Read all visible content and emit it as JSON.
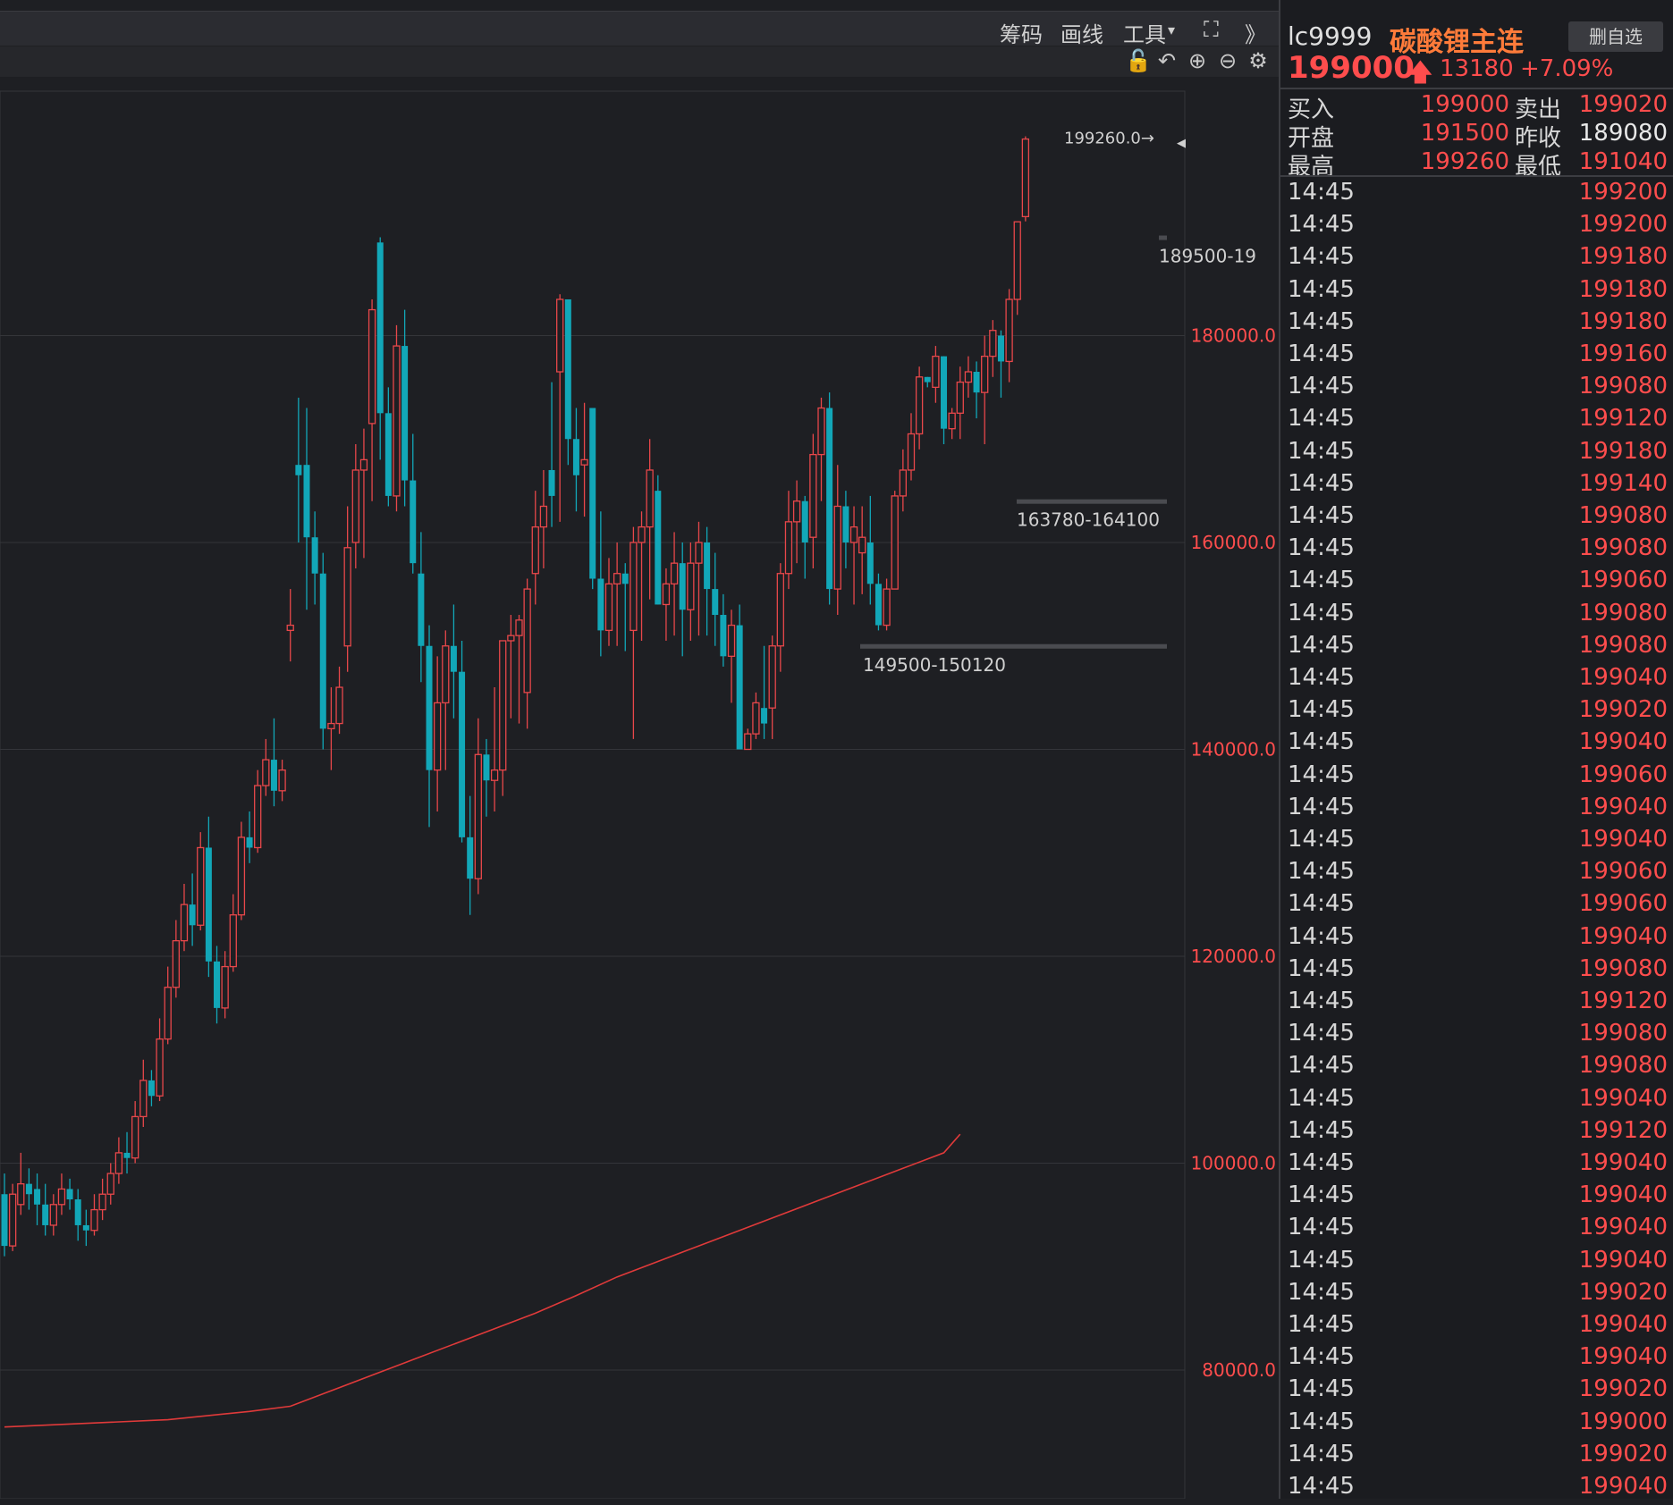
{
  "toolbar": {
    "items": [
      "筹码",
      "画线",
      "工具"
    ],
    "dropdown_glyph": "▾",
    "expand_glyph": "⛶",
    "more_glyph": "》"
  },
  "subbar": {
    "icons": [
      "lock-icon",
      "undo-icon",
      "zoom-in-icon",
      "zoom-out-icon",
      "settings-icon"
    ],
    "glyphs": [
      "🔓",
      "↶",
      "⊕",
      "⊖",
      "⚙"
    ]
  },
  "chart": {
    "y_ticks": [
      "180000.0",
      "160000.0",
      "140000.0",
      "120000.0",
      "100000.0",
      "80000.0"
    ],
    "annotations": {
      "high": "199260.0→",
      "zone1": "189500-19",
      "zone2": "163780-164100",
      "zone3": "149500-150120"
    },
    "colors": {
      "up": "#e8474a",
      "down": "#12a7b8",
      "ma": "#e03a3a",
      "grid": "#34353a"
    }
  },
  "chart_data": {
    "type": "candlestick",
    "ylim": [
      70000,
      205000
    ],
    "y_ticks": [
      80000,
      100000,
      120000,
      140000,
      160000,
      180000
    ],
    "candles": [
      [
        97000,
        92000,
        99000,
        91000
      ],
      [
        92000,
        97000,
        98000,
        91500
      ],
      [
        96000,
        98000,
        101000,
        95000
      ],
      [
        98000,
        97000,
        99500,
        95500
      ],
      [
        97500,
        96000,
        99000,
        94000
      ],
      [
        96000,
        94000,
        98000,
        93000
      ],
      [
        94000,
        96000,
        97000,
        93000
      ],
      [
        96000,
        97500,
        99000,
        95000
      ],
      [
        97500,
        96500,
        98500,
        95500
      ],
      [
        96500,
        94000,
        97500,
        92500
      ],
      [
        94000,
        93500,
        95500,
        92000
      ],
      [
        93500,
        95500,
        97000,
        93000
      ],
      [
        95500,
        97000,
        98500,
        94500
      ],
      [
        97000,
        99000,
        100000,
        96000
      ],
      [
        99000,
        101000,
        102500,
        98000
      ],
      [
        101000,
        100500,
        103000,
        99000
      ],
      [
        100500,
        104500,
        106000,
        100000
      ],
      [
        104500,
        108000,
        110000,
        103500
      ],
      [
        108000,
        106500,
        109000,
        105500
      ],
      [
        106500,
        112000,
        114000,
        106000
      ],
      [
        112000,
        117000,
        119000,
        111500
      ],
      [
        117000,
        121500,
        123500,
        116000
      ],
      [
        121500,
        125000,
        127000,
        120500
      ],
      [
        125000,
        123000,
        128000,
        121000
      ],
      [
        123000,
        130500,
        132000,
        122500
      ],
      [
        130500,
        119500,
        133500,
        118000
      ],
      [
        119500,
        115000,
        121000,
        113500
      ],
      [
        115000,
        119000,
        120500,
        114000
      ],
      [
        119000,
        124000,
        126000,
        118500
      ],
      [
        124000,
        131500,
        133000,
        123500
      ],
      [
        131500,
        130500,
        134000,
        129000
      ],
      [
        130500,
        136500,
        138000,
        130000
      ],
      [
        136500,
        139000,
        141000,
        135500
      ],
      [
        139000,
        136000,
        143000,
        134500
      ],
      [
        136000,
        138000,
        139000,
        135000
      ],
      [
        151500,
        152000,
        155500,
        148500
      ],
      [
        167500,
        166500,
        174000,
        160000
      ],
      [
        167500,
        160500,
        173000,
        153500
      ],
      [
        160500,
        157000,
        163000,
        154000
      ],
      [
        157000,
        142000,
        159000,
        140000
      ],
      [
        142000,
        142500,
        146000,
        138000
      ],
      [
        142500,
        146000,
        148000,
        141500
      ],
      [
        150000,
        159500,
        163500,
        147500
      ],
      [
        160000,
        167000,
        169500,
        157500
      ],
      [
        167000,
        168000,
        171000,
        158500
      ],
      [
        171500,
        182500,
        183500,
        164000
      ],
      [
        189000,
        172500,
        189500,
        168000
      ],
      [
        172500,
        164500,
        175000,
        163500
      ],
      [
        164500,
        179000,
        181000,
        163000
      ],
      [
        179000,
        166000,
        182500,
        163500
      ],
      [
        166000,
        158000,
        170500,
        157000
      ],
      [
        157000,
        150000,
        161000,
        146500
      ],
      [
        150000,
        138000,
        152000,
        132500
      ],
      [
        138000,
        144500,
        149000,
        134000
      ],
      [
        144500,
        150000,
        151500,
        138000
      ],
      [
        150000,
        147500,
        154000,
        143000
      ],
      [
        147500,
        131500,
        150500,
        131000
      ],
      [
        131500,
        127500,
        135500,
        124000
      ],
      [
        127500,
        139500,
        143000,
        126000
      ],
      [
        139500,
        137000,
        141000,
        133500
      ],
      [
        137000,
        138000,
        146000,
        134000
      ],
      [
        138000,
        150500,
        150500,
        135500
      ],
      [
        150500,
        151000,
        153000,
        143000
      ],
      [
        151000,
        152500,
        153000,
        142500
      ],
      [
        145500,
        155500,
        156500,
        142000
      ],
      [
        157000,
        161500,
        165000,
        154000
      ],
      [
        161500,
        163500,
        167000,
        157500
      ],
      [
        167000,
        164500,
        175500,
        161500
      ],
      [
        176500,
        183500,
        184000,
        162000
      ],
      [
        183500,
        170000,
        181000,
        167500
      ],
      [
        170000,
        166500,
        173000,
        163000
      ],
      [
        167500,
        168000,
        173500,
        162500
      ],
      [
        173000,
        156500,
        169000,
        155500
      ],
      [
        156500,
        151500,
        163000,
        149000
      ],
      [
        151500,
        156000,
        158500,
        150000
      ],
      [
        156000,
        157000,
        160000,
        150000
      ],
      [
        157000,
        156000,
        158000,
        149500
      ],
      [
        151500,
        160000,
        161500,
        141000
      ],
      [
        160000,
        161500,
        163000,
        150500
      ],
      [
        161500,
        167000,
        170000,
        154500
      ],
      [
        165000,
        154000,
        166500,
        154000
      ],
      [
        154000,
        156000,
        157500,
        150500
      ],
      [
        156000,
        158000,
        161000,
        151000
      ],
      [
        158000,
        153500,
        160000,
        149000
      ],
      [
        153500,
        158000,
        160000,
        150500
      ],
      [
        158000,
        160000,
        162000,
        151000
      ],
      [
        160000,
        155500,
        161500,
        151000
      ],
      [
        155500,
        153000,
        159000,
        150000
      ],
      [
        153000,
        149000,
        155000,
        148000
      ],
      [
        149000,
        152000,
        153500,
        144500
      ],
      [
        152000,
        140000,
        154000,
        140000
      ],
      [
        140000,
        141500,
        142000,
        141000
      ],
      [
        141500,
        144500,
        145500,
        141000
      ],
      [
        144000,
        142500,
        150000,
        141000
      ],
      [
        144000,
        150000,
        151000,
        141000
      ],
      [
        150000,
        157000,
        158000,
        147500
      ],
      [
        157000,
        162000,
        165000,
        155500
      ],
      [
        162000,
        164000,
        166000,
        158000
      ],
      [
        164000,
        160000,
        164500,
        156500
      ],
      [
        160500,
        168500,
        170500,
        157500
      ],
      [
        168500,
        173000,
        174000,
        164000
      ],
      [
        173000,
        155500,
        174500,
        154000
      ],
      [
        155500,
        163500,
        167500,
        153000
      ],
      [
        163500,
        160000,
        165000,
        157500
      ],
      [
        160000,
        161500,
        163500,
        154000
      ],
      [
        159000,
        160500,
        163500,
        155000
      ],
      [
        160000,
        156000,
        164500,
        154000
      ],
      [
        156000,
        152000,
        157000,
        151500
      ],
      [
        152000,
        155500,
        156500,
        151500
      ],
      [
        155500,
        164500,
        165000,
        155500
      ],
      [
        164500,
        167000,
        169000,
        163000
      ],
      [
        167000,
        170500,
        172500,
        166000
      ],
      [
        170500,
        176000,
        177000,
        169000
      ],
      [
        176000,
        175500,
        176000,
        175000
      ],
      [
        175000,
        178000,
        179000,
        173500
      ],
      [
        178000,
        171000,
        178000,
        169500
      ],
      [
        171000,
        172500,
        173000,
        170000
      ],
      [
        172500,
        175500,
        177000,
        170000
      ],
      [
        175500,
        176500,
        178000,
        174000
      ],
      [
        176500,
        174500,
        177500,
        172000
      ],
      [
        174500,
        178000,
        180000,
        169500
      ],
      [
        178000,
        180500,
        181500,
        176000
      ],
      [
        180000,
        177500,
        180500,
        174000
      ],
      [
        177500,
        183500,
        184500,
        175500
      ],
      [
        183500,
        191000,
        191000,
        182000
      ],
      [
        191500,
        199000,
        199260,
        191040
      ]
    ],
    "ma_line": [
      [
        0,
        74500
      ],
      [
        20,
        75200
      ],
      [
        30,
        76000
      ],
      [
        35,
        76500
      ],
      [
        40,
        78000
      ],
      [
        45,
        79500
      ],
      [
        50,
        81000
      ],
      [
        55,
        82500
      ],
      [
        60,
        84000
      ],
      [
        65,
        85500
      ],
      [
        70,
        87200
      ],
      [
        75,
        89000
      ],
      [
        80,
        90500
      ],
      [
        85,
        92000
      ],
      [
        90,
        93500
      ],
      [
        95,
        95000
      ],
      [
        100,
        96500
      ],
      [
        105,
        98000
      ],
      [
        110,
        99500
      ],
      [
        115,
        101000
      ],
      [
        117,
        102800
      ]
    ],
    "zones": [
      {
        "label": "189500-19",
        "y": 189500
      },
      {
        "label": "163780-164100",
        "y": 164000
      },
      {
        "label": "149500-150120",
        "y": 150000
      }
    ],
    "high_label": {
      "label": "199260.0→",
      "y": 199260
    }
  },
  "panel": {
    "symbol": "lc9999",
    "name": "碳酸锂主连",
    "delete_label": "删自选",
    "last_price": "199000",
    "change": "13180",
    "change_pct": "+7.09%",
    "quote": [
      {
        "l1": "买入",
        "v1": "199000",
        "l2": "卖出",
        "v2": "199020",
        "v2_white": false
      },
      {
        "l1": "开盘",
        "v1": "191500",
        "l2": "昨收",
        "v2": "189080",
        "v2_white": true
      },
      {
        "l1": "最高",
        "v1": "199260",
        "l2": "最低",
        "v2": "191040",
        "v2_white": false
      }
    ],
    "ticks": [
      {
        "t": "14:45",
        "p": "199200"
      },
      {
        "t": "14:45",
        "p": "199200"
      },
      {
        "t": "14:45",
        "p": "199180"
      },
      {
        "t": "14:45",
        "p": "199180"
      },
      {
        "t": "14:45",
        "p": "199180"
      },
      {
        "t": "14:45",
        "p": "199160"
      },
      {
        "t": "14:45",
        "p": "199080"
      },
      {
        "t": "14:45",
        "p": "199120"
      },
      {
        "t": "14:45",
        "p": "199180"
      },
      {
        "t": "14:45",
        "p": "199140"
      },
      {
        "t": "14:45",
        "p": "199080"
      },
      {
        "t": "14:45",
        "p": "199080"
      },
      {
        "t": "14:45",
        "p": "199060"
      },
      {
        "t": "14:45",
        "p": "199080"
      },
      {
        "t": "14:45",
        "p": "199080"
      },
      {
        "t": "14:45",
        "p": "199040"
      },
      {
        "t": "14:45",
        "p": "199020"
      },
      {
        "t": "14:45",
        "p": "199040"
      },
      {
        "t": "14:45",
        "p": "199060"
      },
      {
        "t": "14:45",
        "p": "199040"
      },
      {
        "t": "14:45",
        "p": "199040"
      },
      {
        "t": "14:45",
        "p": "199060"
      },
      {
        "t": "14:45",
        "p": "199060"
      },
      {
        "t": "14:45",
        "p": "199040"
      },
      {
        "t": "14:45",
        "p": "199080"
      },
      {
        "t": "14:45",
        "p": "199120"
      },
      {
        "t": "14:45",
        "p": "199080"
      },
      {
        "t": "14:45",
        "p": "199080"
      },
      {
        "t": "14:45",
        "p": "199040"
      },
      {
        "t": "14:45",
        "p": "199120"
      },
      {
        "t": "14:45",
        "p": "199040"
      },
      {
        "t": "14:45",
        "p": "199040"
      },
      {
        "t": "14:45",
        "p": "199040"
      },
      {
        "t": "14:45",
        "p": "199040"
      },
      {
        "t": "14:45",
        "p": "199020"
      },
      {
        "t": "14:45",
        "p": "199040"
      },
      {
        "t": "14:45",
        "p": "199040"
      },
      {
        "t": "14:45",
        "p": "199020"
      },
      {
        "t": "14:45",
        "p": "199000"
      },
      {
        "t": "14:45",
        "p": "199020"
      },
      {
        "t": "14:45",
        "p": "199040"
      }
    ]
  }
}
